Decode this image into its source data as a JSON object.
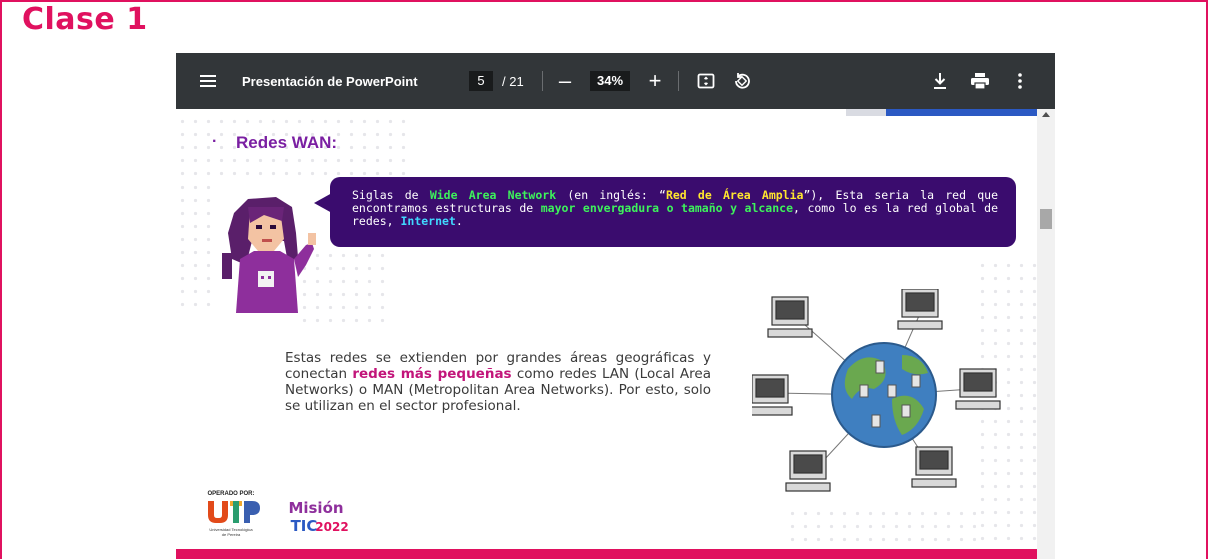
{
  "page": {
    "title": "Clase 1"
  },
  "toolbar": {
    "doc_title": "Presentación de PowerPoint",
    "page_current": "5",
    "page_total": "/ 21",
    "zoom_out_label": "–",
    "zoom": "34%",
    "zoom_in_label": "+",
    "icons": [
      "menu-icon",
      "fit-page-icon",
      "rotate-icon",
      "download-icon",
      "print-icon",
      "more-vert-icon"
    ]
  },
  "slide": {
    "bullet": "·",
    "heading": "Redes WAN:",
    "bubble": {
      "t1": "Siglas de ",
      "wide": "Wide Area Network",
      "t2": " (en inglés: “",
      "red": "Red de Área Amplia",
      "t3": "”), Esta seria la red que encontramos estructuras de ",
      "mayor": "mayor envergadura o tamaño y alcance",
      "t4": ", como lo es la red global de redes, ",
      "internet": "Internet",
      "t5": "."
    },
    "body": {
      "t1": "Estas redes se extienden por grandes áreas geográficas y conectan ",
      "redes": "redes más pequeñas",
      "t2": " como redes LAN (Local Area Networks) o MAN (Metropolitan Area Networks). Por esto, solo se utilizan en el sector profesional."
    },
    "logos": {
      "operado": "OPERADO POR:",
      "utp": "UTP",
      "utp_sub1": "Universidad Tecnológica",
      "utp_sub2": "de Pereira",
      "mision": "Misión",
      "tic": "TIC",
      "year": "2022"
    }
  },
  "colors": {
    "accent": "#e0115f",
    "toolbar": "#323639",
    "bubble": "#3a0c6e",
    "heading": "#7a1fa2"
  }
}
